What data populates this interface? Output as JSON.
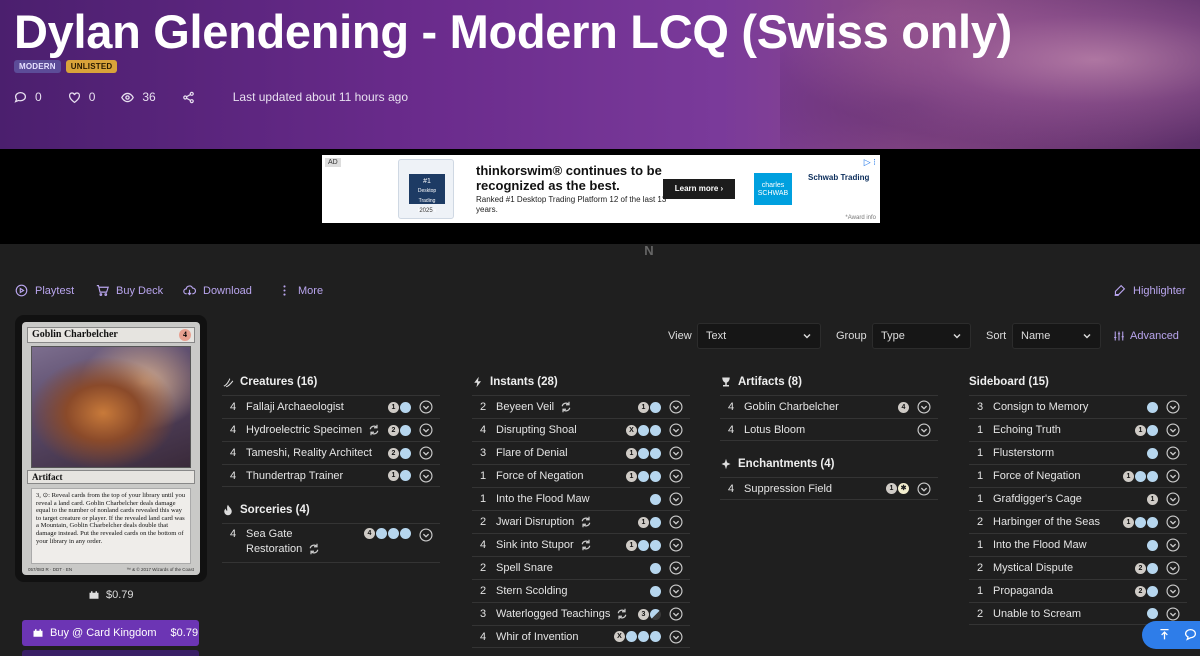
{
  "header": {
    "title": "Dylan Glendening - Modern LCQ (Swiss only)",
    "badges": [
      "MODERN",
      "UNLISTED"
    ],
    "stats": {
      "comments": "0",
      "likes": "0",
      "views": "36"
    },
    "updated": "Last updated about 11 hours ago"
  },
  "ad": {
    "tag": "AD",
    "award_rank": "#1",
    "award_text": "Desktop Trading Platform",
    "award_year": "2025",
    "headline": "thinkorswim® continues to be recognized as the best.",
    "sub": "Ranked #1 Desktop Trading Platform 12 of the last 13 years.",
    "cta": "Learn more ›",
    "brand": "charles SCHWAB",
    "brand2": "Schwab Trading",
    "award_info": "*Award info"
  },
  "toolbar": {
    "playtest": "Playtest",
    "buy_deck": "Buy Deck",
    "download": "Download",
    "more": "More",
    "highlighter": "Highlighter"
  },
  "preview": {
    "name": "Goblin Charbelcher",
    "cost": "4",
    "type": "Artifact",
    "text": "3, ⊙: Reveal cards from the top of your library until you reveal a land card. Goblin Charbelcher deals damage equal to the number of nonland cards revealed this way to target creature or player. If the revealed land card was a Mountain, Goblin Charbelcher deals double that damage instead. Put the revealed cards on the bottom of your library in any order.",
    "footer_left": "057/083 R · DDT · EN",
    "footer_right": "™ & © 2017 Wizards of the Coast",
    "price": "$0.79",
    "buy_label": "Buy @ Card Kingdom",
    "buy_price": "$0.79"
  },
  "controls": {
    "view_label": "View",
    "view_value": "Text",
    "group_label": "Group",
    "group_value": "Type",
    "sort_label": "Sort",
    "sort_value": "Name",
    "advanced": "Advanced"
  },
  "columns": {
    "creatures": {
      "title": "Creatures (16)",
      "cards": [
        {
          "qty": "4",
          "name": "Fallaji Archaeologist",
          "mana": [
            [
              "N",
              "1"
            ],
            [
              "U",
              ""
            ]
          ]
        },
        {
          "qty": "4",
          "name": "Hydroelectric Specimen",
          "mana": [
            [
              "N",
              "2"
            ],
            [
              "U",
              ""
            ]
          ]
        },
        {
          "qty": "4",
          "name": "Tameshi, Reality Architect",
          "mana": [
            [
              "N",
              "2"
            ],
            [
              "U",
              ""
            ]
          ]
        },
        {
          "qty": "4",
          "name": "Thundertrap Trainer",
          "mana": [
            [
              "N",
              "1"
            ],
            [
              "U",
              ""
            ]
          ]
        }
      ]
    },
    "sorceries": {
      "title": "Sorceries (4)",
      "cards": [
        {
          "qty": "4",
          "name": "Sea Gate",
          "name2": "Restoration",
          "mana": [
            [
              "N",
              "4"
            ],
            [
              "U",
              ""
            ],
            [
              "U",
              ""
            ],
            [
              "U",
              ""
            ]
          ]
        }
      ]
    },
    "instants": {
      "title": "Instants (28)",
      "cards": [
        {
          "qty": "2",
          "name": "Beyeen Veil",
          "mana": [
            [
              "N",
              "1"
            ],
            [
              "U",
              ""
            ]
          ]
        },
        {
          "qty": "4",
          "name": "Disrupting Shoal",
          "mana": [
            [
              "N",
              "X"
            ],
            [
              "U",
              ""
            ],
            [
              "U",
              ""
            ]
          ]
        },
        {
          "qty": "3",
          "name": "Flare of Denial",
          "mana": [
            [
              "N",
              "1"
            ],
            [
              "U",
              ""
            ],
            [
              "U",
              ""
            ]
          ]
        },
        {
          "qty": "1",
          "name": "Force of Negation",
          "mana": [
            [
              "N",
              "1"
            ],
            [
              "U",
              ""
            ],
            [
              "U",
              ""
            ]
          ]
        },
        {
          "qty": "1",
          "name": "Into the Flood Maw",
          "mana": [
            [
              "U",
              ""
            ]
          ]
        },
        {
          "qty": "2",
          "name": "Jwari Disruption",
          "mana": [
            [
              "N",
              "1"
            ],
            [
              "U",
              ""
            ]
          ]
        },
        {
          "qty": "4",
          "name": "Sink into Stupor",
          "mana": [
            [
              "N",
              "1"
            ],
            [
              "U",
              ""
            ],
            [
              "U",
              ""
            ]
          ]
        },
        {
          "qty": "2",
          "name": "Spell Snare",
          "mana": [
            [
              "U",
              ""
            ]
          ]
        },
        {
          "qty": "2",
          "name": "Stern Scolding",
          "mana": [
            [
              "U",
              ""
            ]
          ]
        },
        {
          "qty": "3",
          "name": "Waterlogged Teachings",
          "mana": [
            [
              "N",
              "3"
            ],
            [
              "UB",
              ""
            ]
          ]
        },
        {
          "qty": "4",
          "name": "Whir of Invention",
          "mana": [
            [
              "N",
              "X"
            ],
            [
              "U",
              ""
            ],
            [
              "U",
              ""
            ],
            [
              "U",
              ""
            ]
          ]
        }
      ]
    },
    "artifacts": {
      "title": "Artifacts (8)",
      "cards": [
        {
          "qty": "4",
          "name": "Goblin Charbelcher",
          "mana": [
            [
              "N",
              "4"
            ]
          ]
        },
        {
          "qty": "4",
          "name": "Lotus Bloom",
          "mana": []
        }
      ]
    },
    "enchantments": {
      "title": "Enchantments (4)",
      "cards": [
        {
          "qty": "4",
          "name": "Suppression Field",
          "mana": [
            [
              "N",
              "1"
            ],
            [
              "W",
              "✱"
            ]
          ]
        }
      ]
    },
    "sideboard": {
      "title": "Sideboard (15)",
      "cards": [
        {
          "qty": "3",
          "name": "Consign to Memory",
          "mana": [
            [
              "U",
              ""
            ]
          ]
        },
        {
          "qty": "1",
          "name": "Echoing Truth",
          "mana": [
            [
              "N",
              "1"
            ],
            [
              "U",
              ""
            ]
          ]
        },
        {
          "qty": "1",
          "name": "Flusterstorm",
          "mana": [
            [
              "U",
              ""
            ]
          ]
        },
        {
          "qty": "1",
          "name": "Force of Negation",
          "mana": [
            [
              "N",
              "1"
            ],
            [
              "U",
              ""
            ],
            [
              "U",
              ""
            ]
          ]
        },
        {
          "qty": "1",
          "name": "Grafdigger's Cage",
          "mana": [
            [
              "N",
              "1"
            ]
          ]
        },
        {
          "qty": "2",
          "name": "Harbinger of the Seas",
          "mana": [
            [
              "N",
              "1"
            ],
            [
              "U",
              ""
            ],
            [
              "U",
              ""
            ]
          ]
        },
        {
          "qty": "1",
          "name": "Into the Flood Maw",
          "mana": [
            [
              "U",
              ""
            ]
          ]
        },
        {
          "qty": "2",
          "name": "Mystical Dispute",
          "mana": [
            [
              "N",
              "2"
            ],
            [
              "U",
              ""
            ]
          ]
        },
        {
          "qty": "1",
          "name": "Propaganda",
          "mana": [
            [
              "N",
              "2"
            ],
            [
              "U",
              ""
            ]
          ]
        },
        {
          "qty": "2",
          "name": "Unable to Scream",
          "mana": [
            [
              "U",
              ""
            ]
          ]
        }
      ]
    }
  },
  "cycling_cards": [
    "Hydroelectric Specimen",
    "Restoration",
    "Beyeen Veil",
    "Jwari Disruption",
    "Sink into Stupor",
    "Waterlogged Teachings"
  ]
}
